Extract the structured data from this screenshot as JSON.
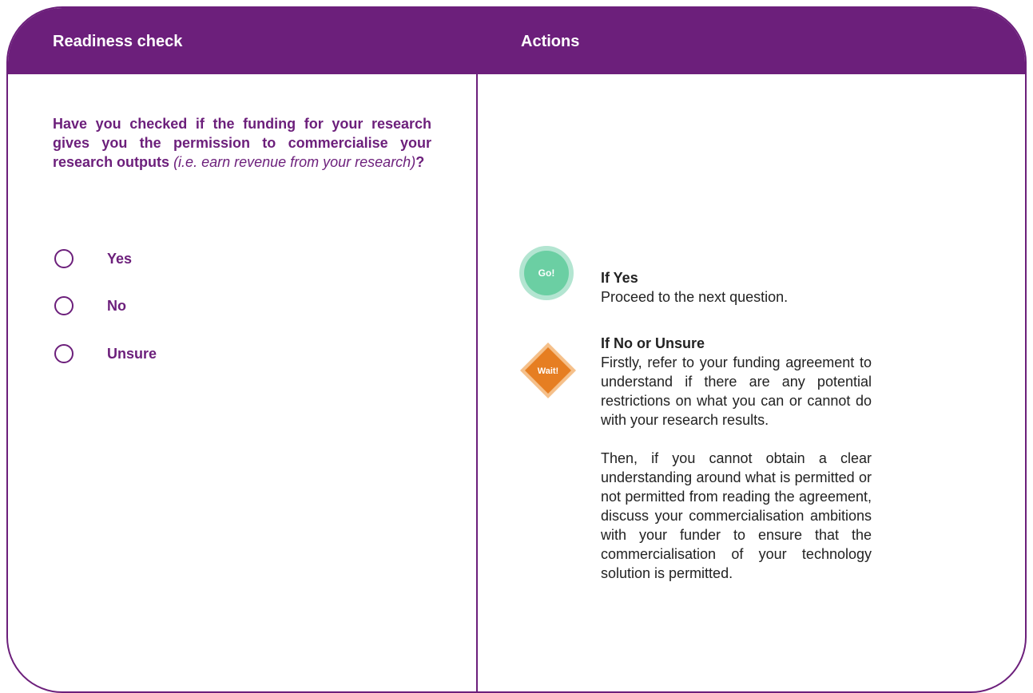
{
  "header": {
    "left_title": "Readiness check",
    "right_title": "Actions"
  },
  "question": {
    "main": "Have you checked if the funding for your research gives you the permission to commercialise your research outputs",
    "aside": "(i.e. earn revenue from your research)",
    "end": "?"
  },
  "options": [
    "Yes",
    "No",
    "Unsure"
  ],
  "actions": {
    "go": {
      "badge": "Go!",
      "heading": "If Yes",
      "body": "Proceed to the next question."
    },
    "wait": {
      "badge": "Wait!",
      "heading": "If No or Unsure",
      "paragraphs": [
        "Firstly, refer to your funding agreement to understand if there are any potential restrictions on what you can or cannot do with your research results.",
        "Then, if you cannot obtain a clear understanding around what is permitted or not permitted from reading the agreement, discuss your commercialisation ambitions with your funder to ensure that the commercialisation of your technology solution is permitted."
      ]
    }
  },
  "colors": {
    "brand_purple": "#6c1f7b",
    "go_green": "#6bcfa3",
    "go_green_light": "#b3e5d1",
    "wait_orange": "#e67e22",
    "wait_orange_light": "#f5c08a"
  }
}
